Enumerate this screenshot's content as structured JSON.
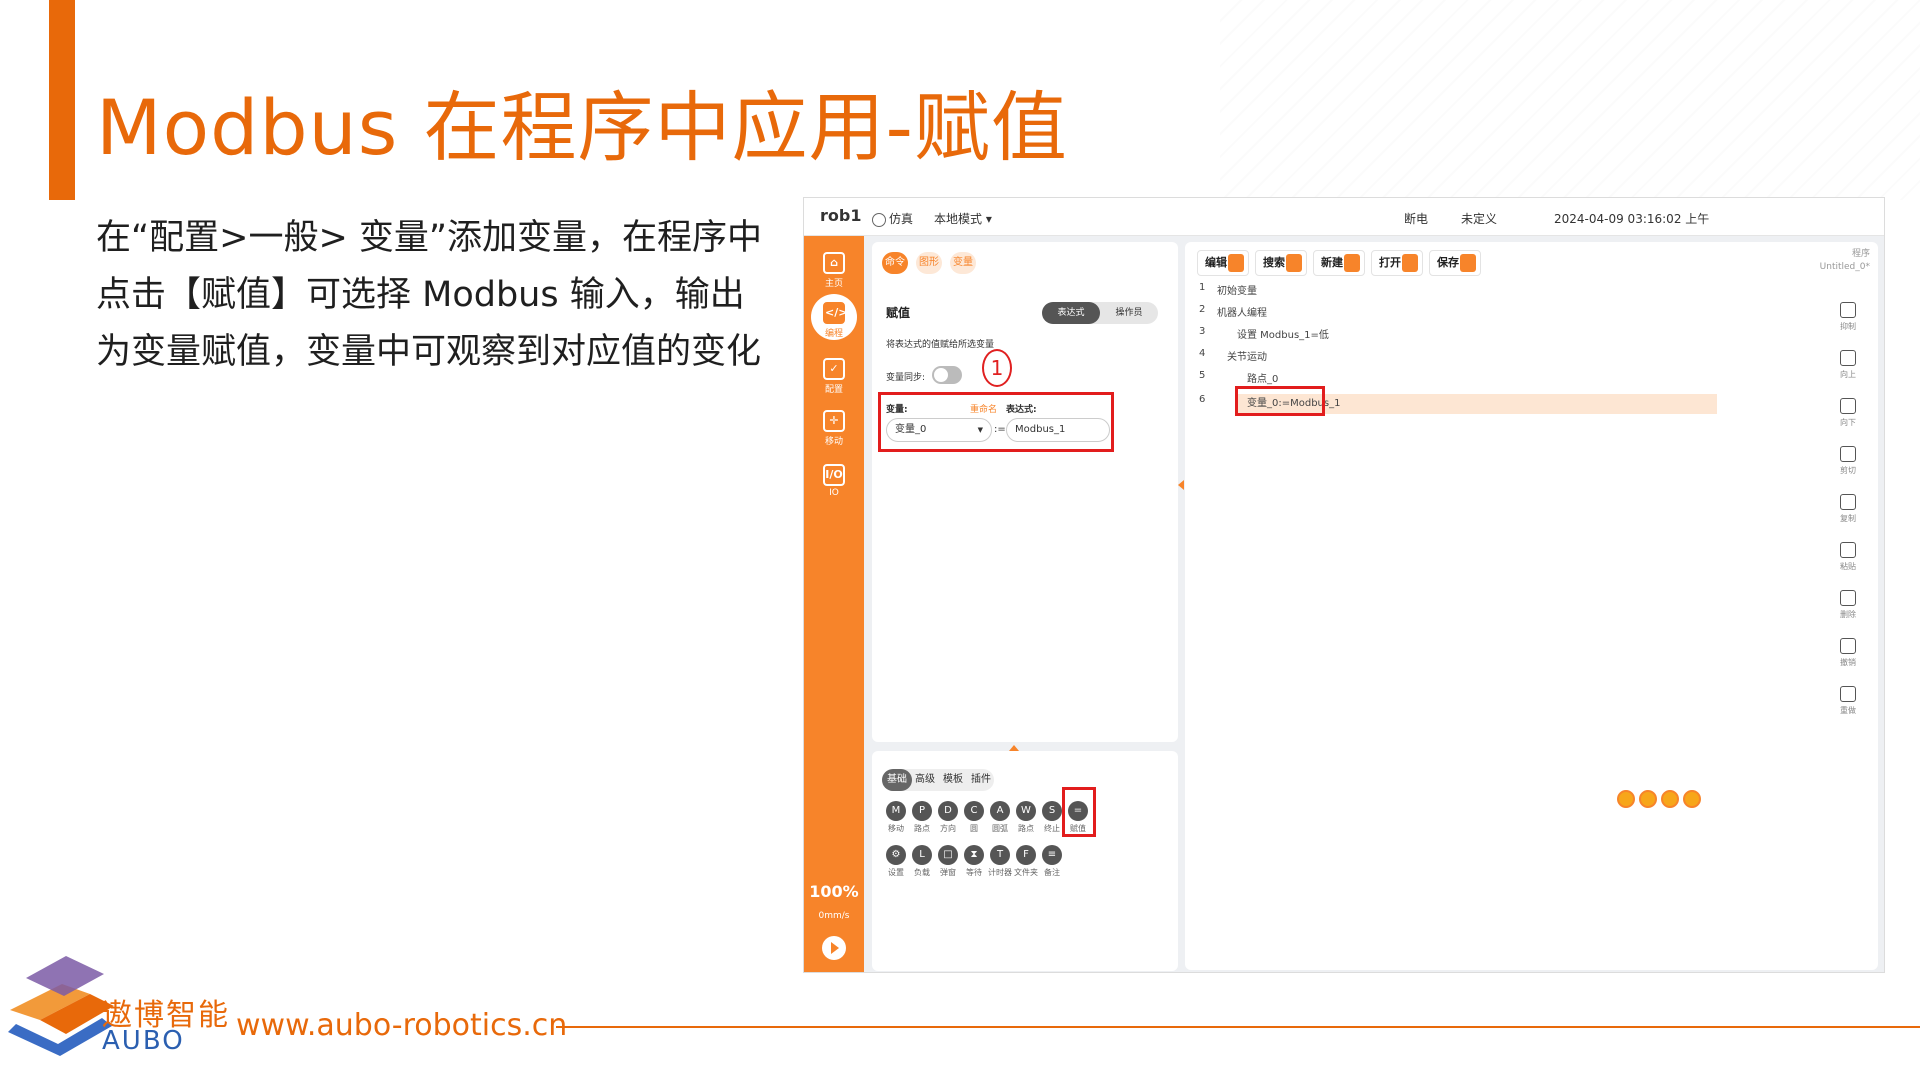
{
  "slide": {
    "title": "Modbus 在程序中应用-赋值",
    "body": "在“配置>一般> 变量”添加变量，在程序中点击【赋值】可选择 Modbus 输入，输出为变量赋值，变量中可观察到对应值的变化",
    "brand_cn": "遨博智能",
    "brand_en": "AUBO",
    "url": "www.aubo-robotics.cn",
    "accent_color": "#e8690a"
  },
  "app": {
    "topbar": {
      "robot": "rob1",
      "mode_sim": "仿真",
      "mode_local": "本地模式 ▾",
      "power": "断电",
      "undefined": "未定义",
      "datetime": "2024-04-09 03:16:02 上午"
    },
    "nav": [
      {
        "label": "主页",
        "icon": "home-icon"
      },
      {
        "label": "编程",
        "icon": "code-icon"
      },
      {
        "label": "配置",
        "icon": "config-icon"
      },
      {
        "label": "移动",
        "icon": "move-icon"
      },
      {
        "label": "IO",
        "icon": "io-icon"
      }
    ],
    "nav_io_glyph": "I/O",
    "speed": "100%",
    "speed_unit": "0mm/s",
    "bottom_marks": "? ? ? ?",
    "cmd_tabs": [
      "命令",
      "图形",
      "变量"
    ],
    "assign": {
      "title": "赋值",
      "desc": "将表达式的值赋给所选变量",
      "mode_expr": "表达式",
      "mode_operator": "操作员",
      "sync_label": "变量同步:",
      "callout": "1",
      "var_label": "变量:",
      "rename": "重命名",
      "expr_label": "表达式:",
      "var_value": "变量_0",
      "assign_op": ":=",
      "expr_value": "Modbus_1"
    },
    "tool_tabs": [
      "基础",
      "高级",
      "模板",
      "插件"
    ],
    "tools_row1": [
      {
        "label": "移动",
        "g": "M"
      },
      {
        "label": "路点",
        "g": "P"
      },
      {
        "label": "方向",
        "g": "D"
      },
      {
        "label": "圆",
        "g": "C"
      },
      {
        "label": "圆弧",
        "g": "A"
      },
      {
        "label": "路点",
        "g": "W"
      },
      {
        "label": "终止",
        "g": "S"
      },
      {
        "label": "赋值",
        "g": "="
      }
    ],
    "tools_row2": [
      {
        "label": "设置",
        "g": "⚙"
      },
      {
        "label": "负载",
        "g": "L"
      },
      {
        "label": "弹窗",
        "g": "□"
      },
      {
        "label": "等待",
        "g": "⧗"
      },
      {
        "label": "计时器",
        "g": "T"
      },
      {
        "label": "文件夹",
        "g": "F"
      },
      {
        "label": "备注",
        "g": "≡"
      }
    ],
    "toolbar": {
      "edit": "编辑",
      "search": "搜索",
      "new": "新建",
      "open": "打开",
      "save": "保存",
      "program_label": "程序",
      "program_name": "Untitled_0*"
    },
    "tree": [
      {
        "n": "1",
        "text": "初始变量"
      },
      {
        "n": "2",
        "text": "机器人编程"
      },
      {
        "n": "3",
        "text": "设置 Modbus_1=低"
      },
      {
        "n": "4",
        "text": "关节运动"
      },
      {
        "n": "5",
        "text": "路点_0"
      },
      {
        "n": "6",
        "text": "变量_0:=Modbus_1"
      }
    ],
    "right_tools": [
      {
        "label": "抑制",
        "icon": "suppress-icon"
      },
      {
        "label": "向上",
        "icon": "up-icon"
      },
      {
        "label": "向下",
        "icon": "down-icon"
      },
      {
        "label": "剪切",
        "icon": "cut-icon"
      },
      {
        "label": "复制",
        "icon": "copy-icon"
      },
      {
        "label": "粘贴",
        "icon": "paste-icon"
      },
      {
        "label": "删除",
        "icon": "delete-icon"
      },
      {
        "label": "撤销",
        "icon": "undo-icon"
      },
      {
        "label": "重做",
        "icon": "redo-icon"
      }
    ],
    "primary_color": "#f7842a",
    "highlight_color": "#e21d1d"
  }
}
